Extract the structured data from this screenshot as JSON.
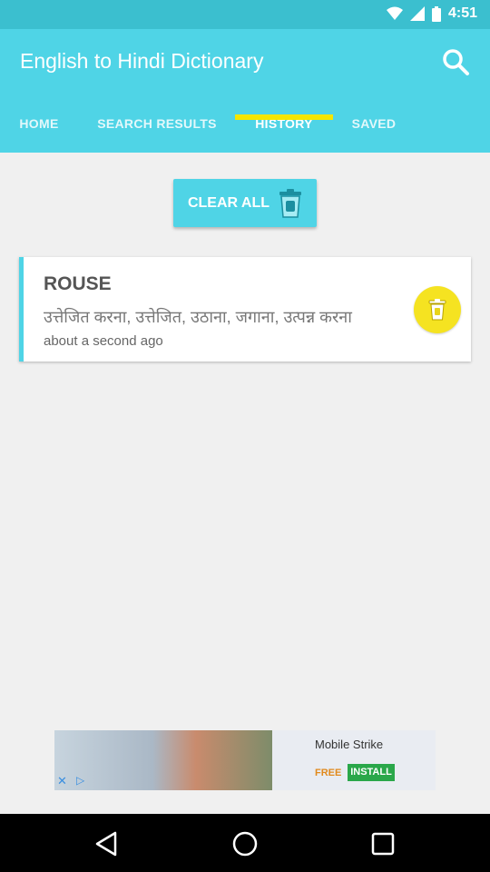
{
  "status_bar": {
    "time": "4:51"
  },
  "app": {
    "title": "English to Hindi Dictionary"
  },
  "tabs": [
    {
      "label": "HOME",
      "active": false
    },
    {
      "label": "SEARCH RESULTS",
      "active": false
    },
    {
      "label": "HISTORY",
      "active": true
    },
    {
      "label": "SAVED",
      "active": false
    }
  ],
  "actions": {
    "clear_all_label": "CLEAR ALL"
  },
  "history": [
    {
      "word": "ROUSE",
      "meaning": "उत्तेजित करना, उत्तेजित, उठाना, जगाना, उत्पन्न करना",
      "time": "about a second ago"
    }
  ],
  "ad": {
    "title": "Mobile Strike",
    "free_label": "FREE",
    "install_label": "INSTALL"
  },
  "colors": {
    "primary": "#4fd4e6",
    "status_bar": "#3bbfcf",
    "indicator": "#f4e600",
    "delete": "#f5e321"
  },
  "icons": [
    "search-icon",
    "trash-icon",
    "back-icon",
    "home-icon",
    "recents-icon",
    "wifi-icon",
    "signal-icon",
    "battery-icon"
  ]
}
